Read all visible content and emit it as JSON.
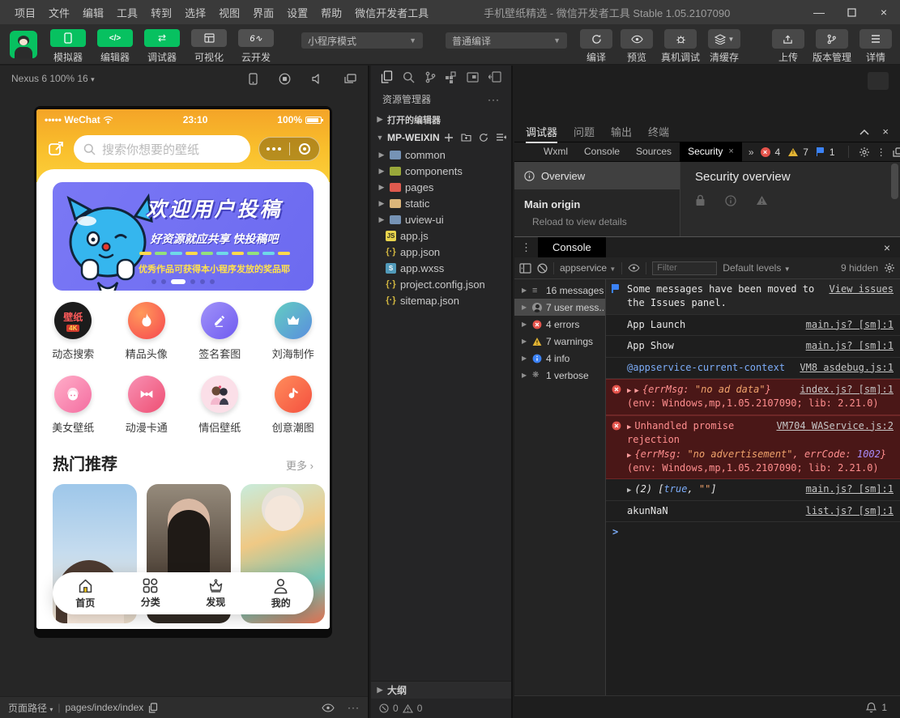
{
  "colors": {
    "accent_green": "#07c160",
    "phone_amber": "#f9bf2c",
    "banner_purple": "#6c6af0",
    "error_red": "#e5534b",
    "warn_yellow": "#e2b434",
    "info_blue": "#3b82f6"
  },
  "titlebar": {
    "menus": [
      "项目",
      "文件",
      "编辑",
      "工具",
      "转到",
      "选择",
      "视图",
      "界面",
      "设置",
      "帮助",
      "微信开发者工具"
    ],
    "title": "手机壁纸精选 - 微信开发者工具 Stable 1.05.2107090"
  },
  "toolbar": {
    "nav": [
      {
        "label": "模拟器"
      },
      {
        "label": "编辑器"
      },
      {
        "label": "调试器"
      },
      {
        "label": "可视化"
      },
      {
        "label": "云开发"
      }
    ],
    "mode_dropdown": "小程序模式",
    "compile_dropdown": "普通编译",
    "actions": [
      {
        "label": "编译"
      },
      {
        "label": "预览"
      },
      {
        "label": "真机调试"
      },
      {
        "label": "清缓存"
      }
    ],
    "right_actions": [
      {
        "label": "上传"
      },
      {
        "label": "版本管理"
      },
      {
        "label": "详情"
      }
    ]
  },
  "simulator": {
    "device": "Nexus 6 100% 16",
    "statusbar": {
      "carrier": "••••• WeChat",
      "time": "23:10",
      "battery": "100%"
    },
    "search_placeholder": "搜索你想要的壁纸",
    "banner": {
      "line1": "欢迎用户投稿",
      "line2": "好资源就应共享  快投稿吧",
      "line3": "优秀作品可获得本小程序发放的奖品耶"
    },
    "grid": [
      {
        "label": "动态搜索",
        "glyph": "壁纸",
        "sub": "4K"
      },
      {
        "label": "精品头像"
      },
      {
        "label": "签名套图"
      },
      {
        "label": "刘海制作"
      },
      {
        "label": "美女壁纸"
      },
      {
        "label": "动漫卡通"
      },
      {
        "label": "情侣壁纸"
      },
      {
        "label": "创意潮图"
      }
    ],
    "section": {
      "title": "热门推荐",
      "more": "更多 ›"
    },
    "tabbar": [
      {
        "label": "首页"
      },
      {
        "label": "分类"
      },
      {
        "label": "发现"
      },
      {
        "label": "我的"
      }
    ],
    "footer": {
      "path_label": "页面路径",
      "path": "pages/index/index"
    }
  },
  "explorer": {
    "header": "资源管理器",
    "open_editors": "打开的编辑器",
    "project": "MP-WEIXIN",
    "tree": [
      {
        "name": "common"
      },
      {
        "name": "components"
      },
      {
        "name": "pages"
      },
      {
        "name": "static"
      },
      {
        "name": "uview-ui"
      },
      {
        "name": "app.js"
      },
      {
        "name": "app.json"
      },
      {
        "name": "app.wxss"
      },
      {
        "name": "project.config.json"
      },
      {
        "name": "sitemap.json"
      }
    ],
    "outline": "大纲",
    "problems": {
      "errors": "0",
      "warnings": "0"
    }
  },
  "debugger": {
    "panel_tabs": [
      {
        "label": "调试器"
      },
      {
        "label": "问题"
      },
      {
        "label": "输出"
      },
      {
        "label": "终端"
      }
    ],
    "devtools_tabs": [
      {
        "label": "Wxml"
      },
      {
        "label": "Console"
      },
      {
        "label": "Sources"
      },
      {
        "label": "Security"
      }
    ],
    "badges": {
      "errors": "4",
      "warnings": "7",
      "issues": "1"
    },
    "security": {
      "sidebar_item": "Overview",
      "main_origin": "Main origin",
      "reload": "Reload to view details",
      "title": "Security overview"
    },
    "console": {
      "tab": "Console",
      "context": "appservice",
      "filter_placeholder": "Filter",
      "levels": "Default levels",
      "hidden": "9 hidden",
      "sidebar": [
        {
          "label": "16 messages"
        },
        {
          "label": "7 user mess..."
        },
        {
          "label": "4 errors"
        },
        {
          "label": "7 warnings"
        },
        {
          "label": "4 info"
        },
        {
          "label": "1 verbose"
        }
      ],
      "messages": {
        "m1": {
          "text": "Some messages have been moved to the Issues panel.",
          "link": "View issues"
        },
        "m2": {
          "text": "App Launch",
          "link": "main.js? [sm]:1"
        },
        "m3": {
          "text": "App Show",
          "link": "main.js? [sm]:1"
        },
        "m4": {
          "text": "@appservice-current-context",
          "link": "VM8 asdebug.js:1"
        },
        "m5": {
          "open": "{errMsg: ",
          "str": "\"no ad data\"",
          "close": "}",
          "link": "index.js? [sm]:1",
          "env": "(env: Windows,mp,1.05.2107090; lib: 2.21.0)"
        },
        "m6": {
          "line1": "Unhandled promise rejection",
          "link": "VM704 WAService.js:2",
          "open": "{errMsg: ",
          "str": "\"no advertisement\"",
          "mid": ", errCode: ",
          "num": "1002",
          "close": "}",
          "env": "(env: Windows,mp,1.05.2107090; lib: 2.21.0)"
        },
        "m7": {
          "pre": "(2) [",
          "bool": "true",
          "mid": ", ",
          "str": "\"\"",
          "close": "]",
          "link": "main.js? [sm]:1"
        },
        "m8": {
          "text": "akunNaN",
          "link": "list.js? [sm]:1"
        },
        "prompt": ">"
      }
    },
    "statusbar": {
      "notifications": "1"
    }
  }
}
